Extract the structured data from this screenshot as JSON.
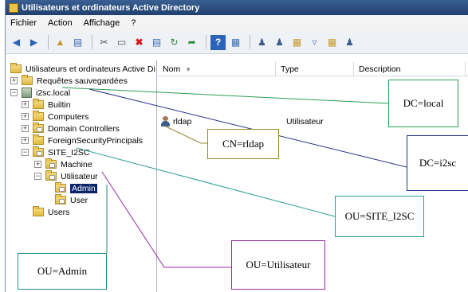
{
  "window": {
    "title": "Utilisateurs et ordinateurs Active Directory"
  },
  "doc_fragment": [
    "r",
    ".",
    "é",
    "r",
    ".",
    "s",
    "s"
  ],
  "menu": [
    "Fichier",
    "Action",
    "Affichage",
    "?"
  ],
  "tree": {
    "root": "Utilisateurs et ordinateurs Active Di",
    "saved_queries": "Requêtes sauvegardées",
    "domain": "i2sc.local",
    "builtin": "Builtin",
    "computers": "Computers",
    "domain_controllers": "Domain Controllers",
    "fsp": "ForeignSecurityPrincipals",
    "site": "SITE_I2SC",
    "machine": "Machine",
    "utilisateur": "Utilisateur",
    "admin": "Admin",
    "user": "User",
    "users": "Users"
  },
  "list": {
    "columns": [
      "Nom",
      "Type",
      "Description"
    ],
    "rows": [
      {
        "name": "rldap",
        "type": "Utilisateur"
      }
    ]
  },
  "annotations": {
    "dc_local": "DC=local",
    "cn_rldap": "CN=rldap",
    "dc_i2sc": "DC=i2sc",
    "ou_site": "OU=SITE_I2SC",
    "ou_utilisateur": "OU=Utilisateur",
    "ou_admin": "OU=Admin"
  },
  "colors": {
    "green": "#2e9b53",
    "olive": "#8f8a2b",
    "navy": "#2a2f86",
    "teal": "#2f9c94",
    "purple": "#9b2aa8",
    "teal2": "#1f8e86"
  }
}
